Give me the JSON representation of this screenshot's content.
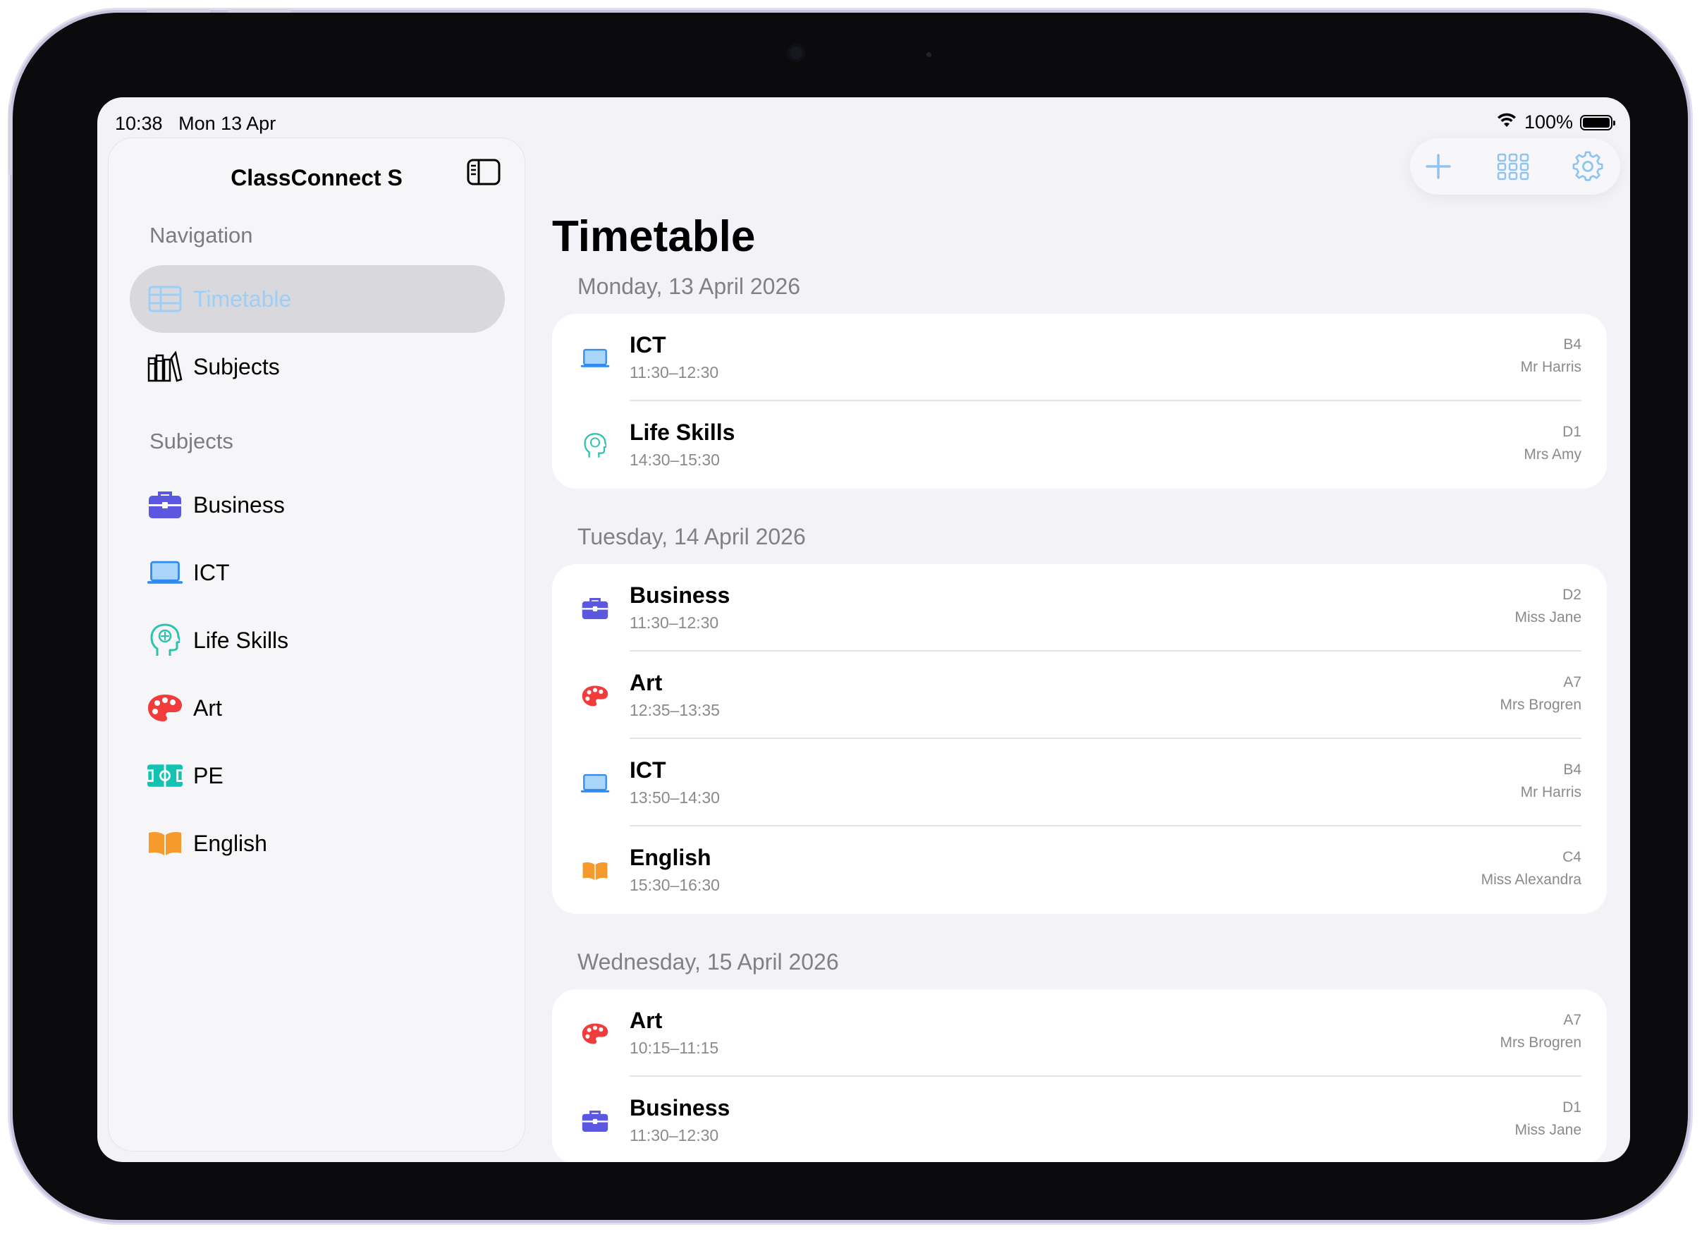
{
  "status_bar": {
    "time": "10:38",
    "date": "Mon 13 Apr",
    "battery": "100%"
  },
  "sidebar": {
    "title": "ClassConnect S",
    "navigation_heading": "Navigation",
    "navigation": [
      {
        "label": "Timetable",
        "icon": "table-icon",
        "selected": true
      },
      {
        "label": "Subjects",
        "icon": "books-icon",
        "selected": false
      }
    ],
    "subjects_heading": "Subjects",
    "subjects": [
      {
        "label": "Business",
        "icon": "briefcase-icon",
        "color": "#5b57e0"
      },
      {
        "label": "ICT",
        "icon": "laptop-icon",
        "color": "#2f8bf0"
      },
      {
        "label": "Life Skills",
        "icon": "head-brain-icon",
        "color": "#2cc3ae"
      },
      {
        "label": "Art",
        "icon": "palette-icon",
        "color": "#f23b3b"
      },
      {
        "label": "PE",
        "icon": "pitch-icon",
        "color": "#14c2b4"
      },
      {
        "label": "English",
        "icon": "open-book-icon",
        "color": "#f79a2c"
      }
    ]
  },
  "toolbar": {
    "add": "plus-icon",
    "grid": "grid-icon",
    "settings": "gear-icon"
  },
  "main": {
    "title": "Timetable",
    "days": [
      {
        "date": "Monday, 13 April 2026",
        "lessons": [
          {
            "subject": "ICT",
            "time": "11:30–12:30",
            "room": "B4",
            "teacher": "Mr Harris",
            "icon": "laptop-icon"
          },
          {
            "subject": "Life Skills",
            "time": "14:30–15:30",
            "room": "D1",
            "teacher": "Mrs Amy",
            "icon": "head-brain-icon"
          }
        ]
      },
      {
        "date": "Tuesday, 14 April 2026",
        "lessons": [
          {
            "subject": "Business",
            "time": "11:30–12:30",
            "room": "D2",
            "teacher": "Miss Jane",
            "icon": "briefcase-icon"
          },
          {
            "subject": "Art",
            "time": "12:35–13:35",
            "room": "A7",
            "teacher": "Mrs Brogren",
            "icon": "palette-icon"
          },
          {
            "subject": "ICT",
            "time": "13:50–14:30",
            "room": "B4",
            "teacher": "Mr Harris",
            "icon": "laptop-icon"
          },
          {
            "subject": "English",
            "time": "15:30–16:30",
            "room": "C4",
            "teacher": "Miss Alexandra",
            "icon": "open-book-icon"
          }
        ]
      },
      {
        "date": "Wednesday, 15 April 2026",
        "lessons": [
          {
            "subject": "Art",
            "time": "10:15–11:15",
            "room": "A7",
            "teacher": "Mrs Brogren",
            "icon": "palette-icon"
          },
          {
            "subject": "Business",
            "time": "11:30–12:30",
            "room": "D1",
            "teacher": "Miss Jane",
            "icon": "briefcase-icon"
          }
        ]
      }
    ]
  },
  "colors": {
    "accent": "#2f8bf0",
    "selection": "#d9d9dd",
    "selected_label": "#9fcef4"
  }
}
